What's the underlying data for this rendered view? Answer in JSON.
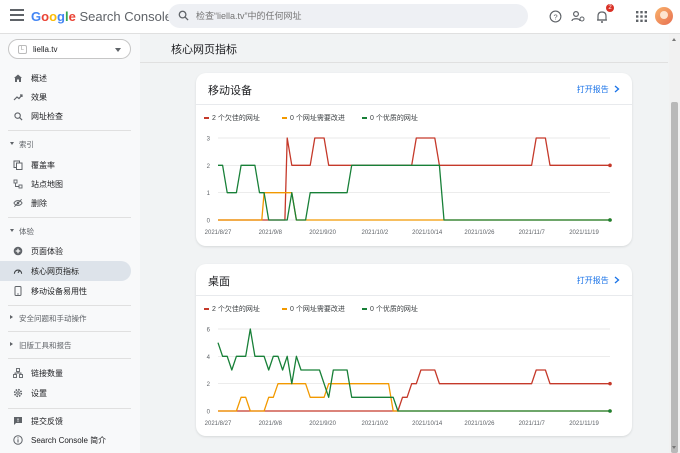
{
  "header": {
    "brand_google": "Google",
    "brand_product": "Search Console",
    "search_placeholder": "检查“liella.tv”中的任何网址",
    "notification_count": "2"
  },
  "sidebar": {
    "property": "liella.tv",
    "items": [
      {
        "label": "概述"
      },
      {
        "label": "效果"
      },
      {
        "label": "网址检查"
      }
    ],
    "section_index": "索引",
    "index_items": [
      {
        "label": "覆盖率"
      },
      {
        "label": "站点地图"
      },
      {
        "label": "删除"
      }
    ],
    "section_experience": "体验",
    "experience_items": [
      {
        "label": "页面体验"
      },
      {
        "label": "核心网页指标"
      },
      {
        "label": "移动设备易用性"
      }
    ],
    "section_security": "安全问题和手动操作",
    "section_legacy": "旧版工具和报告",
    "bottom_items": [
      {
        "label": "链接数量"
      },
      {
        "label": "设置"
      }
    ],
    "footer_items": [
      {
        "label": "提交反馈"
      },
      {
        "label": "Search Console 简介"
      }
    ]
  },
  "main": {
    "page_title": "核心网页指标",
    "open_report": "打开报告",
    "mobile_title": "移动设备",
    "desktop_title": "桌面"
  },
  "colors": {
    "poor": "#c5392a",
    "needs_improvement": "#f29900",
    "good": "#188038",
    "link": "#1a73e8"
  },
  "chart_data": [
    {
      "type": "line",
      "title": "移动设备",
      "legend": "top-left",
      "grid": true,
      "ylim": [
        0,
        3
      ],
      "yticks": [
        "0",
        "1",
        "2",
        "3"
      ],
      "x_tick_labels": [
        "2021/8/27",
        "2021/9/8",
        "2021/9/20",
        "2021/10/2",
        "2021/10/14",
        "2021/10/26",
        "2021/11/7",
        "2021/11/19"
      ],
      "series": [
        {
          "name": "2 个欠佳的网址",
          "color": "#c5392a",
          "points": [
            [
              0,
              0
            ],
            [
              14.5,
              0
            ],
            [
              15,
              3
            ],
            [
              16,
              2
            ],
            [
              20,
              2
            ],
            [
              21,
              3
            ],
            [
              23,
              3
            ],
            [
              24,
              2
            ],
            [
              42,
              2
            ],
            [
              43,
              3
            ],
            [
              47,
              3
            ],
            [
              48,
              2
            ],
            [
              68,
              2
            ],
            [
              69,
              3
            ],
            [
              71,
              3
            ],
            [
              72,
              2
            ],
            [
              85,
              2
            ]
          ]
        },
        {
          "name": "0 个网址需要改进",
          "color": "#f29900",
          "points": [
            [
              0,
              0
            ],
            [
              9.5,
              0
            ],
            [
              10,
              1
            ],
            [
              16,
              1
            ],
            [
              17,
              0
            ],
            [
              85,
              0
            ]
          ]
        },
        {
          "name": "0 个优质的网址",
          "color": "#188038",
          "points": [
            [
              0,
              2
            ],
            [
              1,
              2
            ],
            [
              2,
              1
            ],
            [
              4,
              1
            ],
            [
              5,
              2
            ],
            [
              8,
              2
            ],
            [
              9,
              1
            ],
            [
              10,
              1
            ],
            [
              11,
              0
            ],
            [
              15,
              0
            ],
            [
              16,
              1
            ],
            [
              17,
              0
            ],
            [
              19,
              0
            ],
            [
              20,
              1
            ],
            [
              28,
              1
            ],
            [
              29,
              2
            ],
            [
              48,
              2
            ],
            [
              49,
              0
            ],
            [
              85,
              0
            ]
          ]
        }
      ]
    },
    {
      "type": "line",
      "title": "桌面",
      "legend": "top-left",
      "grid": true,
      "ylim": [
        0,
        6
      ],
      "yticks": [
        "0",
        "2",
        "4",
        "6"
      ],
      "x_tick_labels": [
        "2021/8/27",
        "2021/9/8",
        "2021/9/20",
        "2021/10/2",
        "2021/10/14",
        "2021/10/26",
        "2021/11/7",
        "2021/11/19"
      ],
      "series": [
        {
          "name": "2 个欠佳的网址",
          "color": "#c5392a",
          "points": [
            [
              0,
              0
            ],
            [
              39,
              0
            ],
            [
              40,
              1
            ],
            [
              41,
              1
            ],
            [
              42,
              2
            ],
            [
              43,
              2
            ],
            [
              44,
              3
            ],
            [
              47,
              3
            ],
            [
              48,
              2
            ],
            [
              68,
              2
            ],
            [
              69,
              3
            ],
            [
              71,
              3
            ],
            [
              72,
              2
            ],
            [
              85,
              2
            ]
          ]
        },
        {
          "name": "0 个网址需要改进",
          "color": "#f29900",
          "points": [
            [
              0,
              0
            ],
            [
              4,
              0
            ],
            [
              5,
              1
            ],
            [
              6,
              1
            ],
            [
              7,
              0
            ],
            [
              10,
              0
            ],
            [
              11,
              1
            ],
            [
              12,
              1
            ],
            [
              13,
              2
            ],
            [
              19,
              2
            ],
            [
              20,
              1
            ],
            [
              23,
              1
            ],
            [
              24,
              2
            ],
            [
              37,
              2
            ],
            [
              38,
              0
            ],
            [
              85,
              0
            ]
          ]
        },
        {
          "name": "0 个优质的网址",
          "color": "#188038",
          "points": [
            [
              0,
              5
            ],
            [
              1,
              4
            ],
            [
              2,
              4
            ],
            [
              3,
              3
            ],
            [
              4,
              4
            ],
            [
              6,
              4
            ],
            [
              7,
              6
            ],
            [
              8,
              4
            ],
            [
              10,
              4
            ],
            [
              11,
              3
            ],
            [
              12,
              4
            ],
            [
              13,
              4
            ],
            [
              14,
              3
            ],
            [
              15,
              4
            ],
            [
              16,
              2
            ],
            [
              17,
              4
            ],
            [
              18,
              3
            ],
            [
              22,
              3
            ],
            [
              23,
              2
            ],
            [
              24,
              1
            ],
            [
              25,
              3
            ],
            [
              28,
              3
            ],
            [
              29,
              1
            ],
            [
              38,
              1
            ],
            [
              39,
              0
            ],
            [
              85,
              0
            ]
          ]
        }
      ]
    }
  ]
}
